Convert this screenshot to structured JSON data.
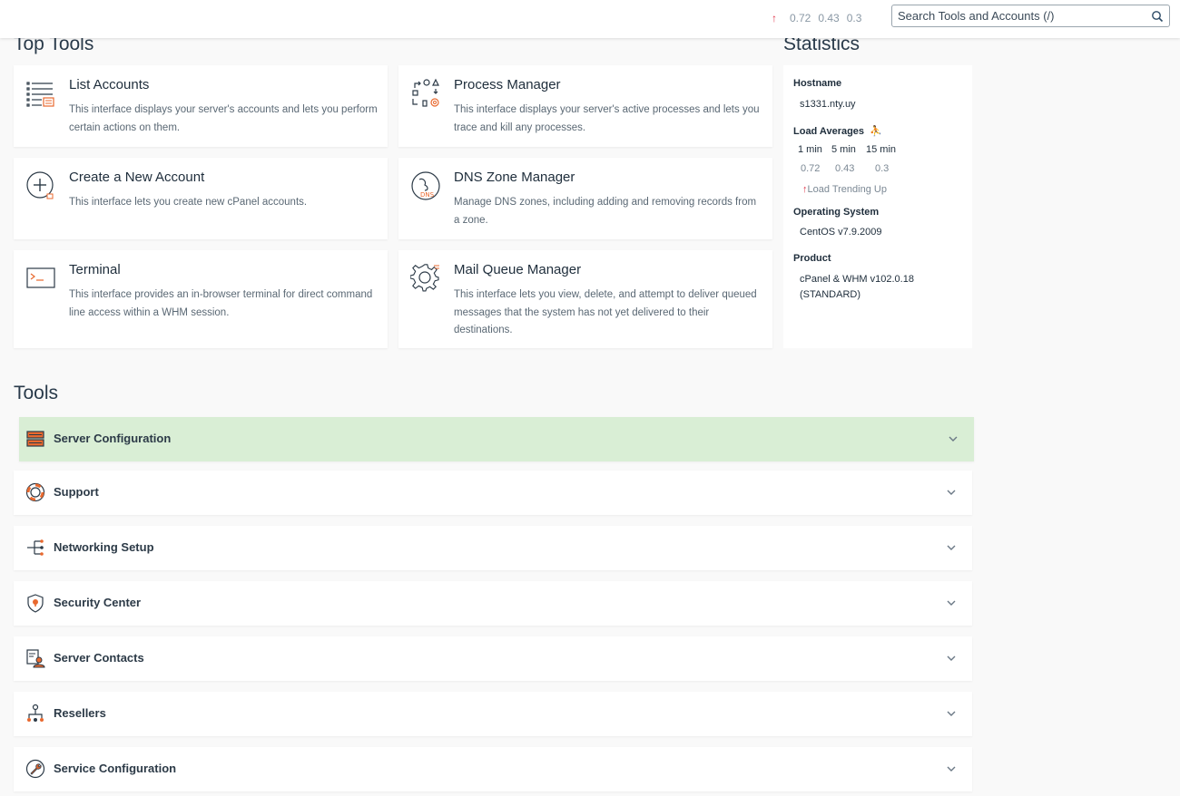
{
  "header": {
    "load": [
      "0.72",
      "0.43",
      "0.3"
    ],
    "search_placeholder": "Search Tools and Accounts (/)"
  },
  "top_tools": {
    "title": "Top Tools",
    "cards": [
      {
        "title": "List Accounts",
        "desc": "This interface displays your server's accounts and lets you perform certain actions on them.",
        "icon": "list-accounts-icon"
      },
      {
        "title": "Process Manager",
        "desc": "This interface displays your server's active processes and lets you trace and kill any processes.",
        "icon": "process-manager-icon"
      },
      {
        "title": "Create a New Account",
        "desc": "This interface lets you create new cPanel accounts.",
        "icon": "create-account-icon"
      },
      {
        "title": "DNS Zone Manager",
        "desc": "Manage DNS zones, including adding and removing records from a zone.",
        "icon": "dns-zone-icon"
      },
      {
        "title": "Terminal",
        "desc": "This interface provides an in-browser terminal for direct command line access within a WHM session.",
        "icon": "terminal-icon"
      },
      {
        "title": "Mail Queue Manager",
        "desc": "This interface lets you view, delete, and attempt to deliver queued messages that the system has not yet delivered to their destinations.",
        "icon": "gear-icon"
      }
    ]
  },
  "statistics": {
    "title": "Statistics",
    "hostname_label": "Hostname",
    "hostname": "s1331.nty.uy",
    "load_label": "Load Averages",
    "load_headers": [
      "1 min",
      "5 min",
      "15 min"
    ],
    "load_values": [
      "0.72",
      "0.43",
      "0.3"
    ],
    "trend": "Load Trending Up",
    "os_label": "Operating System",
    "os": "CentOS v7.9.2009",
    "product_label": "Product",
    "product_line1": "cPanel & WHM v102.0.18",
    "product_line2": "(STANDARD)"
  },
  "tools": {
    "title": "Tools",
    "sections": [
      {
        "label": "Server Configuration",
        "icon": "server-icon",
        "active": true
      },
      {
        "label": "Support",
        "icon": "lifebuoy-icon"
      },
      {
        "label": "Networking Setup",
        "icon": "network-icon"
      },
      {
        "label": "Security Center",
        "icon": "shield-icon"
      },
      {
        "label": "Server Contacts",
        "icon": "contacts-icon"
      },
      {
        "label": "Resellers",
        "icon": "resellers-icon"
      },
      {
        "label": "Service Configuration",
        "icon": "wrench-icon"
      }
    ]
  },
  "colors": {
    "accent": "#e8692f",
    "active_section_bg": "#d9eed5",
    "trend_up": "#e0354a"
  }
}
